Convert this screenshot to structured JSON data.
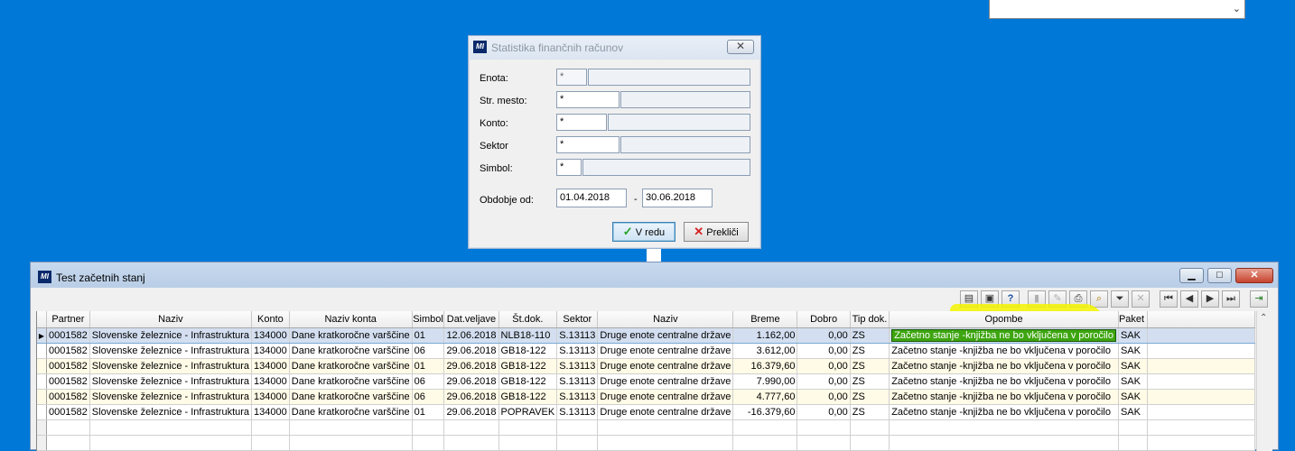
{
  "dialog": {
    "title": "Statistika finančnih računov",
    "fields": [
      {
        "label": "Enota:",
        "value": "*"
      },
      {
        "label": "Str. mesto:",
        "value": "*"
      },
      {
        "label": "Konto:",
        "value": "*"
      },
      {
        "label": "Sektor",
        "value": "*"
      },
      {
        "label": "Simbol:",
        "value": "*"
      }
    ],
    "period_label": "Obdobje od:",
    "date_from": "01.04.2018",
    "date_sep": "-",
    "date_to": "30.06.2018",
    "ok_label": "V redu",
    "cancel_label": "Prekliči"
  },
  "window": {
    "title": "Test začetnih stanj"
  },
  "grid": {
    "columns": [
      "Partner",
      "Naziv",
      "Konto",
      "Naziv konta",
      "Simbol",
      "Dat.veljave",
      "Št.dok.",
      "Sektor",
      "Naziv",
      "Breme",
      "Dobro",
      "Tip dok.",
      "Opombe",
      "Paket"
    ],
    "rows": [
      [
        "0001582",
        "Slovenske železnice - Infrastruktura",
        "134000",
        "Dane kratkoročne varščine",
        "01",
        "12.06.2018",
        "NLB18-110",
        "S.13113",
        "Druge enote centralne države",
        "1.162,00",
        "0,00",
        "ZS",
        "Začetno stanje -knjižba ne bo vključena v poročilo",
        "SAK"
      ],
      [
        "0001582",
        "Slovenske železnice - Infrastruktura",
        "134000",
        "Dane kratkoročne varščine",
        "06",
        "29.06.2018",
        "GB18-122",
        "S.13113",
        "Druge enote centralne države",
        "3.612,00",
        "0,00",
        "ZS",
        "Začetno stanje -knjižba ne bo vključena v poročilo",
        "SAK"
      ],
      [
        "0001582",
        "Slovenske železnice - Infrastruktura",
        "134000",
        "Dane kratkoročne varščine",
        "01",
        "29.06.2018",
        "GB18-122",
        "S.13113",
        "Druge enote centralne države",
        "16.379,60",
        "0,00",
        "ZS",
        "Začetno stanje -knjižba ne bo vključena v poročilo",
        "SAK"
      ],
      [
        "0001582",
        "Slovenske železnice - Infrastruktura",
        "134000",
        "Dane kratkoročne varščine",
        "06",
        "29.06.2018",
        "GB18-122",
        "S.13113",
        "Druge enote centralne države",
        "7.990,00",
        "0,00",
        "ZS",
        "Začetno stanje -knjižba ne bo vključena v poročilo",
        "SAK"
      ],
      [
        "0001582",
        "Slovenske železnice - Infrastruktura",
        "134000",
        "Dane kratkoročne varščine",
        "06",
        "29.06.2018",
        "GB18-122",
        "S.13113",
        "Druge enote centralne države",
        "4.777,60",
        "0,00",
        "ZS",
        "Začetno stanje -knjižba ne bo vključena v poročilo",
        "SAK"
      ],
      [
        "0001582",
        "Slovenske železnice - Infrastruktura",
        "134000",
        "Dane kratkoročne varščine",
        "01",
        "29.06.2018",
        "POPRAVEK",
        "S.13113",
        "Druge enote centralne države",
        "-16.379,60",
        "0,00",
        "ZS",
        "Začetno stanje -knjižba ne bo vključena v poročilo",
        "SAK"
      ]
    ]
  }
}
